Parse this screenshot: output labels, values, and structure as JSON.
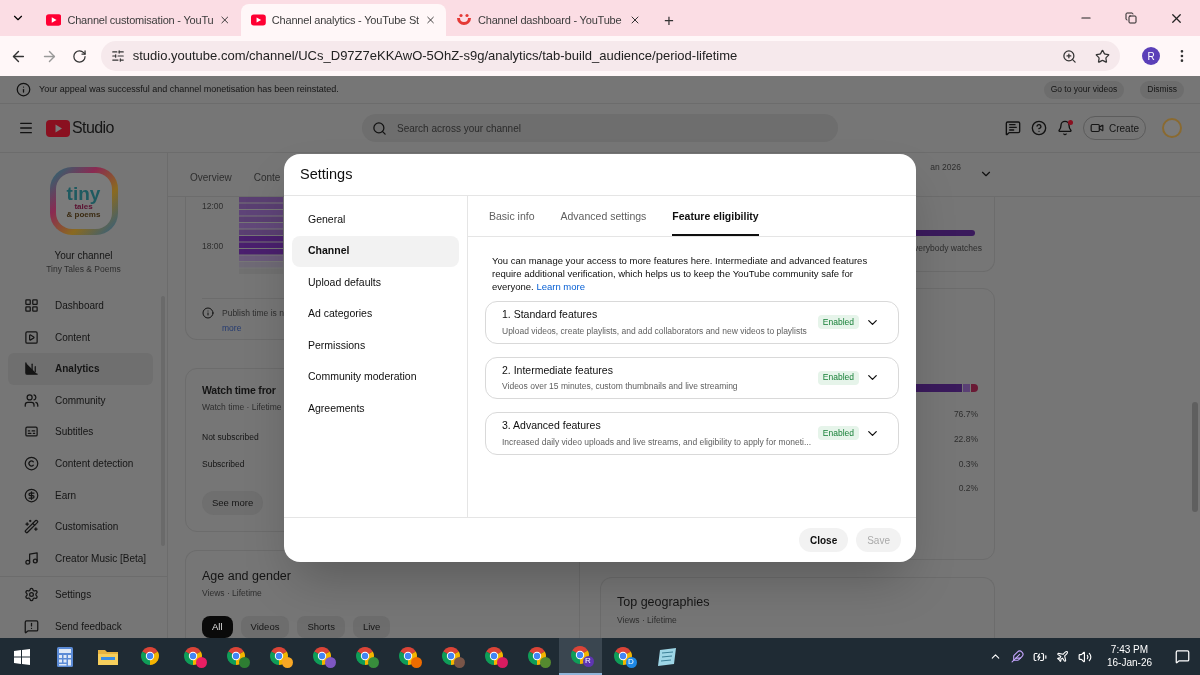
{
  "browser": {
    "tabs": [
      {
        "kind": "youtube",
        "title": "Channel customisation - YouTu",
        "selected": false
      },
      {
        "kind": "youtube",
        "title": "Channel analytics - YouTube St",
        "selected": true
      },
      {
        "kind": "dashboard",
        "title": "Channel dashboard - YouTube",
        "selected": false
      }
    ],
    "new_tab": "+",
    "url": "studio.youtube.com/channel/UCs_D97Z7eKKAwO-5OhZ-s9g/analytics/tab-build_audience/period-lifetime",
    "profile": "R"
  },
  "banner": {
    "message": "Your appeal was successful and channel monetisation has been reinstated.",
    "buttons": [
      "Go to your videos",
      "Dismiss"
    ]
  },
  "header": {
    "logo": "Studio",
    "search": {
      "placeholder": "Search across your channel"
    },
    "create": "Create"
  },
  "sidebar": {
    "logo_lines": [
      "tiny",
      "tales",
      "& poems"
    ],
    "title": "Your channel",
    "subtitle": "Tiny Tales & Poems",
    "items": [
      {
        "label": "Dashboard",
        "selected": false
      },
      {
        "label": "Content",
        "selected": false
      },
      {
        "label": "Analytics",
        "selected": true
      },
      {
        "label": "Community",
        "selected": false
      },
      {
        "label": "Subtitles",
        "selected": false
      },
      {
        "label": "Content detection",
        "selected": false
      },
      {
        "label": "Earn",
        "selected": false
      },
      {
        "label": "Customisation",
        "selected": false
      },
      {
        "label": "Creator Music [Beta]",
        "selected": false
      }
    ],
    "footer_items": [
      "Settings",
      "Send feedback"
    ]
  },
  "analytics": {
    "tabs": [
      "Overview",
      "Conte"
    ],
    "period": "an 2026",
    "publish_card": {
      "hour_labels": [
        "12:00",
        "18:00"
      ],
      "note": "Publish time is n",
      "note_link": "more"
    },
    "watch_card": {
      "title": "Watch time fror",
      "subtitle": "Watch time · Lifetime",
      "rows": [
        "Not subscribed",
        "Subscribed"
      ],
      "button": "See more"
    },
    "age_card": {
      "title": "Age and gender",
      "subtitle": "Views · Lifetime",
      "chips": [
        {
          "label": "All",
          "selected": true
        },
        {
          "label": "Videos",
          "selected": false
        },
        {
          "label": "Shorts",
          "selected": false
        },
        {
          "label": "Live",
          "selected": false
        }
      ]
    },
    "audience_card": {
      "caption": "verybody watches"
    },
    "shares_card": {
      "shares": [
        "76.7%",
        "22.8%",
        "0.3%",
        "0.2%"
      ]
    },
    "geo_card": {
      "title": "Top geographies",
      "subtitle": "Views · Lifetime"
    }
  },
  "dialog": {
    "title": "Settings",
    "nav": [
      {
        "label": "General",
        "selected": false
      },
      {
        "label": "Channel",
        "selected": true
      },
      {
        "label": "Upload defaults",
        "selected": false
      },
      {
        "label": "Ad categories",
        "selected": false
      },
      {
        "label": "Permissions",
        "selected": false
      },
      {
        "label": "Community moderation",
        "selected": false
      },
      {
        "label": "Agreements",
        "selected": false
      }
    ],
    "tabs": [
      {
        "label": "Basic info",
        "selected": false
      },
      {
        "label": "Advanced settings",
        "selected": false
      },
      {
        "label": "Feature eligibility",
        "selected": true
      }
    ],
    "intro": "You can manage your access to more features here. Intermediate and advanced features require additional verification, which helps us to keep the YouTube community safe for everyone.",
    "intro_link": "Learn more",
    "features": [
      {
        "title": "1. Standard features",
        "description": "Upload videos, create playlists, and add collaborators and new videos to playlists",
        "status": "Enabled",
        "enabled": true
      },
      {
        "title": "2. Intermediate features",
        "description": "Videos over 15 minutes, custom thumbnails and live streaming",
        "status": "Enabled",
        "enabled": true
      },
      {
        "title": "3. Advanced features",
        "description": "Increased daily video uploads and live streams, and eligibility to apply for moneti...",
        "status": "Enabled",
        "enabled": true
      }
    ],
    "buttons": [
      {
        "label": "Close",
        "disabled": false
      },
      {
        "label": "Save",
        "disabled": true
      }
    ]
  },
  "taskbar": {
    "apps": [
      {
        "kind": "start",
        "active": false
      },
      {
        "kind": "calculator",
        "active": false
      },
      {
        "kind": "files",
        "active": false
      },
      {
        "kind": "chrome",
        "active": false
      },
      {
        "kind": "chrome",
        "color": "#e91e63",
        "active": false
      },
      {
        "kind": "chrome",
        "color": "#2e7d32",
        "active": false
      },
      {
        "kind": "chrome",
        "color": "#f9a825",
        "active": false
      },
      {
        "kind": "chrome",
        "color": "#7e57c2",
        "active": false
      },
      {
        "kind": "chrome",
        "color": "#388e3c",
        "active": false
      },
      {
        "kind": "chrome",
        "color": "#ef6c00",
        "active": false
      },
      {
        "kind": "chrome",
        "color": "#795548",
        "active": false
      },
      {
        "kind": "chrome",
        "color": "#d81b60",
        "active": false
      },
      {
        "kind": "chrome",
        "color": "#558b2f",
        "active": false
      },
      {
        "kind": "chrome",
        "color": "#5e35b1",
        "letter": "R",
        "active": true
      },
      {
        "kind": "chrome",
        "color": "#1e88e5",
        "letter": "D",
        "active": false
      },
      {
        "kind": "notes",
        "active": false
      }
    ],
    "time": "7:43 PM",
    "date": "16-Jan-26"
  }
}
